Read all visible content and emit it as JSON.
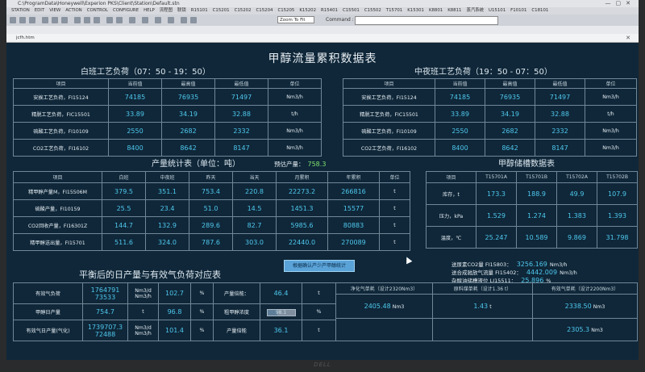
{
  "window": {
    "title": "C:\\ProgramData\\Honeywell\\Experion PKS\\Client\\Station\\Default.stn",
    "document_tab": "jcfh.htm"
  },
  "menu": [
    "STATION",
    "EDIT",
    "VIEW",
    "ACTION",
    "CONTROL",
    "CONFIGURE",
    "HELP",
    "流程图",
    "联锁",
    "R15101",
    "C15201",
    "C15202",
    "C15204",
    "C15205",
    "K15202",
    "R15401",
    "C15501",
    "C15502",
    "T15701",
    "K15301",
    "K8801",
    "K8811",
    "蒸汽系统",
    "U15101",
    "F10101",
    "C18101"
  ],
  "toolbar": {
    "zoom": "Zoom To Fit",
    "command_label": "Command :",
    "command_value": ""
  },
  "title": "甲醇流量累积数据表",
  "day_shift": {
    "title": "白班工艺负荷（07：50 - 19：50）",
    "headers": [
      "项目",
      "当前值",
      "最高值",
      "最低值",
      "单位"
    ],
    "rows": [
      {
        "label": "安挨工艺负荷，FI15124",
        "cur": "74185",
        "max": "76935",
        "min": "71497",
        "unit": "Nm3/h"
      },
      {
        "label": "精脱工艺负荷，FIC15501",
        "cur": "33.89",
        "max": "34.19",
        "min": "32.88",
        "unit": "t/h"
      },
      {
        "label": "硫酸工艺负荷，FI10109",
        "cur": "2550",
        "max": "2682",
        "min": "2332",
        "unit": "Nm3/h"
      },
      {
        "label": "CO2工艺负荷，FI16102",
        "cur": "8400",
        "max": "8642",
        "min": "8147",
        "unit": "Nm3/h"
      }
    ]
  },
  "night_shift": {
    "title": "中夜班工艺负荷（19：50 - 07：50）",
    "headers": [
      "项目",
      "当前值",
      "最高值",
      "最低值",
      "单位"
    ],
    "rows": [
      {
        "label": "安挨工艺负荷，FI15124",
        "cur": "74185",
        "max": "76935",
        "min": "71497",
        "unit": "Nm3/h"
      },
      {
        "label": "精脱工艺负荷，FIC15501",
        "cur": "33.89",
        "max": "34.19",
        "min": "32.88",
        "unit": "t/h"
      },
      {
        "label": "硫酸工艺负荷，FI10109",
        "cur": "2550",
        "max": "2682",
        "min": "2332",
        "unit": "Nm3/h"
      },
      {
        "label": "CO2工艺负荷，FI16102",
        "cur": "8400",
        "max": "8642",
        "min": "8147",
        "unit": "Nm3/h"
      }
    ]
  },
  "production": {
    "title": "产量统计表（单位：吨）",
    "pred_label": "预估产量：",
    "pred_value": "758.3",
    "headers": [
      "项目",
      "白班",
      "中夜班",
      "昨天",
      "当天",
      "月累积",
      "年累积",
      "单位"
    ],
    "rows": [
      {
        "label": "精甲醇产量M，FI15506M",
        "c1": "379.5",
        "c2": "351.1",
        "c3": "753.4",
        "c4": "220.8",
        "c5": "22273.2",
        "c6": "266816",
        "unit": "t"
      },
      {
        "label": "硫酸产量，FI10159",
        "c1": "25.5",
        "c2": "23.4",
        "c3": "51.0",
        "c4": "14.5",
        "c5": "1451.3",
        "c6": "15577",
        "unit": "t"
      },
      {
        "label": "CO2回收产量，FI16301Z",
        "c1": "144.7",
        "c2": "132.9",
        "c3": "289.6",
        "c4": "82.7",
        "c5": "5985.6",
        "c6": "80883",
        "unit": "t"
      },
      {
        "label": "精甲醇送出量，FI15701",
        "c1": "511.6",
        "c2": "324.0",
        "c3": "787.6",
        "c4": "303.0",
        "c5": "22440.0",
        "c6": "270089",
        "unit": "t"
      }
    ]
  },
  "storage": {
    "title": "甲醇储槽数据表",
    "headers": [
      "项目",
      "T15701A",
      "T15701B",
      "T15702A",
      "T15702B"
    ],
    "rows": [
      {
        "label": "库存，t",
        "a": "173.3",
        "b": "188.9",
        "c": "49.9",
        "d": "107.9"
      },
      {
        "label": "压力，kPa",
        "a": "1.529",
        "b": "1.274",
        "c": "1.383",
        "d": "1.393"
      },
      {
        "label": "温度，℃",
        "a": "25.247",
        "b": "10.589",
        "c": "9.869",
        "d": "31.798"
      }
    ]
  },
  "balance_title": "平衡后的日产量与有效气负荷对应表",
  "popup_button": "根据确认产少产甲醇统计",
  "info": [
    {
      "label": "送尿素CO2量 FI15803：",
      "value": "3256.169",
      "unit": "Nm3/h"
    },
    {
      "label": "送合成驰放气流量 FI15402：",
      "value": "4442.009",
      "unit": "Nm3/h"
    },
    {
      "label": "杂醇油储槽液位 LI15511：",
      "value": "25.896",
      "unit": "%"
    }
  ],
  "balance": {
    "r1": {
      "label": "有效气负荷",
      "v1": "1764791",
      "v2": "73533",
      "u1": "Nm3/d",
      "u2": "Nm3/h",
      "pct": "102.7",
      "pu": "%",
      "k": "产量倍能：",
      "kv": "46.4",
      "ku": "t"
    },
    "r2": {
      "label": "甲醇日产量",
      "v1": "754.7",
      "u1": "t",
      "pct": "96.8",
      "pu": "%",
      "k": "粗甲醇浓度",
      "kv": "98.1",
      "ku": "%"
    },
    "r3": {
      "label": "有效气日产量(气化)",
      "v1": "1739707.3",
      "v2": "72488",
      "u1": "Nm3/d",
      "u2": "Nm3/h",
      "pct": "101.4",
      "pu": "%",
      "k": "产量倍能",
      "kv": "36.1",
      "ku": "t"
    },
    "cons_headers": [
      "净化气单耗（设计2320Nm3）",
      "原料煤单耗（设计1.36 t）",
      "有效气单耗（设计2200Nm3）"
    ],
    "cons1": {
      "value": "2405.48",
      "unit": "Nm3"
    },
    "cons2": {
      "value": "1.43",
      "unit": "t"
    },
    "cons3a": {
      "value": "2338.50",
      "unit": "Nm3"
    },
    "cons3b": {
      "value": "2305.3",
      "unit": "Nm3"
    }
  },
  "slider_level": 0.35,
  "monitor_brand": "DELL"
}
